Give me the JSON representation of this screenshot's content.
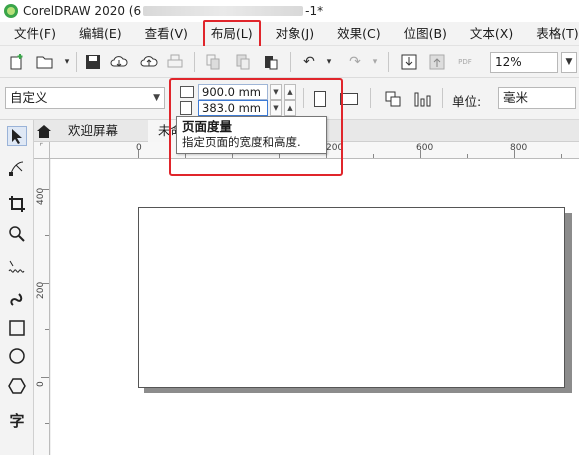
{
  "window": {
    "title_prefix": "CorelDRAW 2020 (6",
    "title_suffix": "-1*"
  },
  "menu": {
    "items": [
      {
        "label": "文件(F)"
      },
      {
        "label": "编辑(E)"
      },
      {
        "label": "查看(V)"
      },
      {
        "label": "布局(L)"
      },
      {
        "label": "对象(J)"
      },
      {
        "label": "效果(C)"
      },
      {
        "label": "位图(B)"
      },
      {
        "label": "文本(X)"
      },
      {
        "label": "表格(T)"
      }
    ]
  },
  "toolbar": {
    "zoom_value": "12%",
    "pdf_label": "PDF"
  },
  "property_bar": {
    "page_preset": "自定义",
    "page_width": "900.0 mm",
    "page_height": "383.0 mm",
    "units_label": "单位:",
    "units_value": "毫米"
  },
  "tooltip": {
    "title": "页面度量",
    "description": "指定页面的宽度和高度."
  },
  "tabs": {
    "welcome": "欢迎屏幕",
    "document": "未命"
  },
  "ruler": {
    "top_labels": [
      "0",
      "200",
      "400",
      "600",
      "800"
    ],
    "left_labels": [
      "400",
      "200",
      "0"
    ]
  },
  "toolbox": {
    "text_tool_glyph": "字"
  },
  "colors": {
    "highlight": "#e0252b",
    "canvas": "#ffffff",
    "page_shadow": "#8c8c8c"
  }
}
